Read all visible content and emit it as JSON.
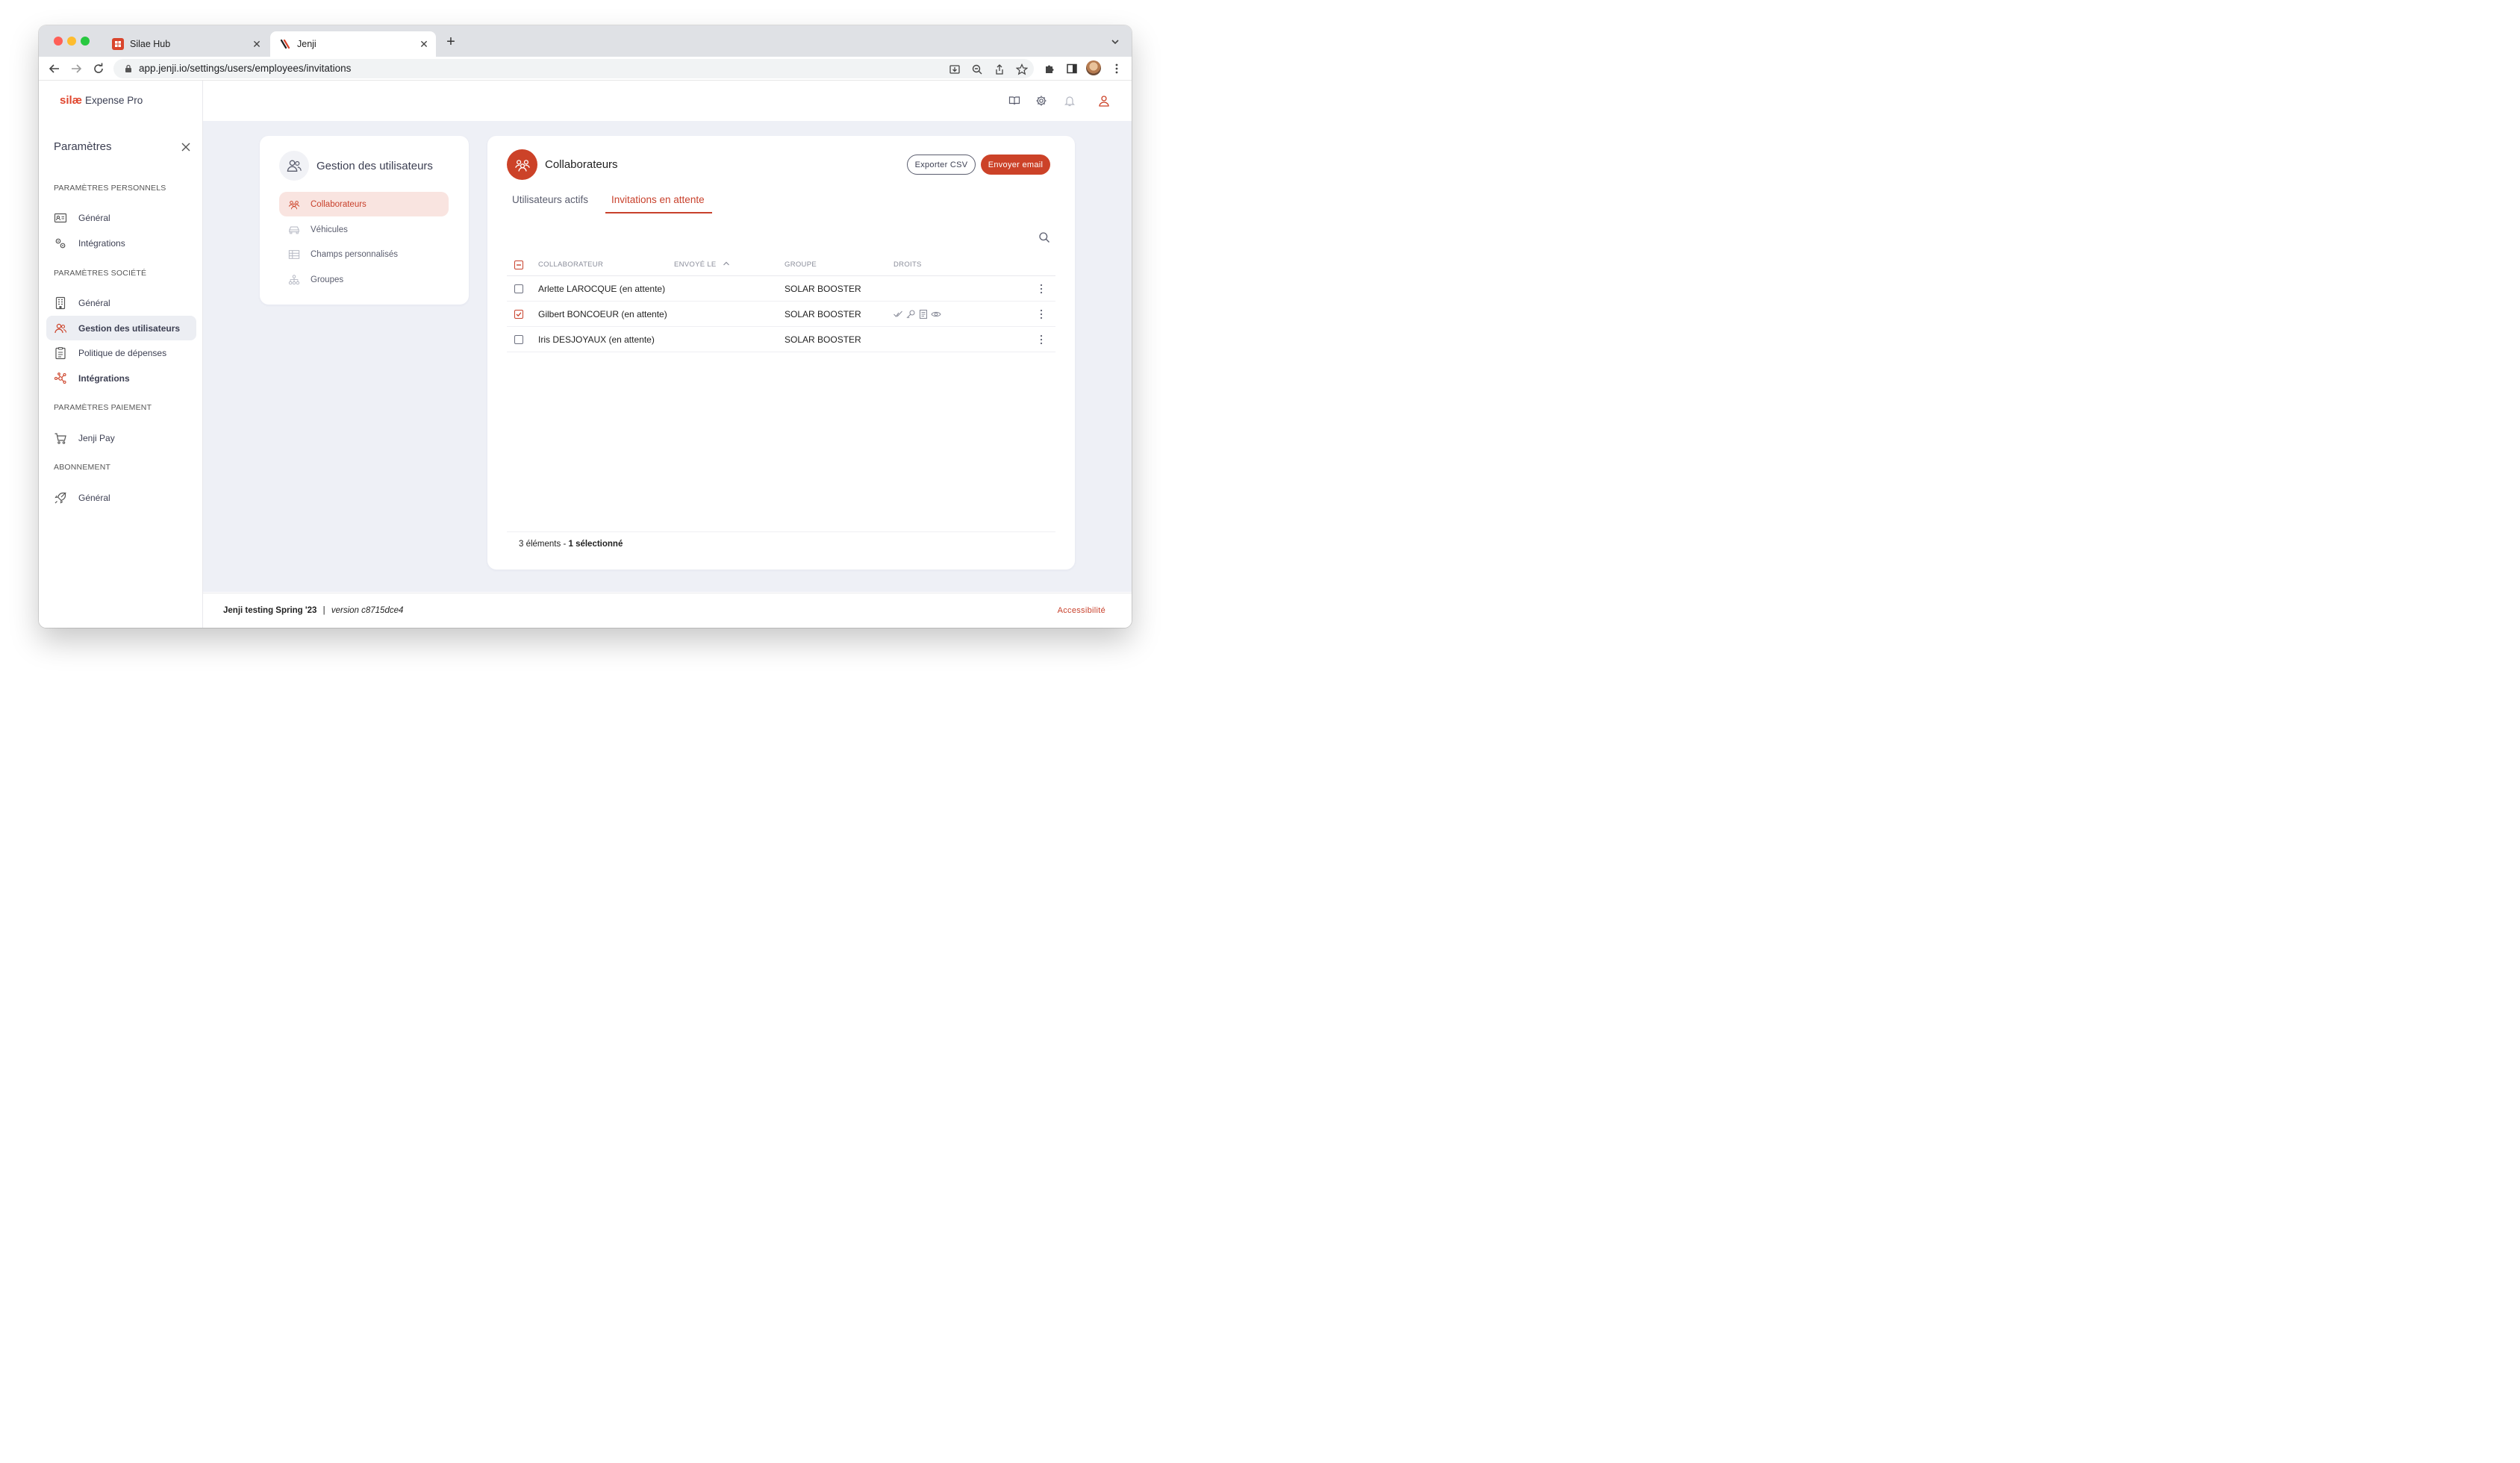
{
  "browser": {
    "tabs": [
      {
        "title": "Silae Hub",
        "active": false
      },
      {
        "title": "Jenji",
        "active": true
      }
    ],
    "url": "app.jenji.io/settings/users/employees/invitations",
    "new_tab_label": "+",
    "close_glyph": "✕"
  },
  "logo": {
    "mark": "silæ",
    "product": "Expense Pro"
  },
  "sidebar": {
    "title": "Paramètres",
    "sections": [
      {
        "label": "PARAMÈTRES PERSONNELS",
        "items": [
          {
            "label": "Général",
            "icon": "id-card-icon"
          },
          {
            "label": "Intégrations",
            "icon": "gears-icon"
          }
        ]
      },
      {
        "label": "PARAMÈTRES SOCIÉTÉ",
        "items": [
          {
            "label": "Général",
            "icon": "building-icon"
          },
          {
            "label": "Gestion des utilisateurs",
            "icon": "users-icon",
            "active": true
          },
          {
            "label": "Politique de dépenses",
            "icon": "clipboard-icon"
          },
          {
            "label": "Intégrations",
            "icon": "network-icon",
            "bold": true
          }
        ]
      },
      {
        "label": "PARAMÈTRES PAIEMENT",
        "items": [
          {
            "label": "Jenji Pay",
            "icon": "cart-icon"
          }
        ]
      },
      {
        "label": "ABONNEMENT",
        "items": [
          {
            "label": "Général",
            "icon": "rocket-icon"
          }
        ]
      }
    ]
  },
  "submenu": {
    "title": "Gestion des utilisateurs",
    "items": [
      {
        "label": "Collaborateurs",
        "icon": "users-icon",
        "active": true
      },
      {
        "label": "Véhicules",
        "icon": "car-icon"
      },
      {
        "label": "Champs personnalisés",
        "icon": "table-icon"
      },
      {
        "label": "Groupes",
        "icon": "hierarchy-icon"
      }
    ]
  },
  "main": {
    "title": "Collaborateurs",
    "export_label": "Exporter CSV",
    "send_label": "Envoyer email",
    "tabs": [
      {
        "label": "Utilisateurs actifs",
        "active": false
      },
      {
        "label": "Invitations en attente",
        "active": true
      }
    ],
    "columns": {
      "collaborator": "COLLABORATEUR",
      "sent": "ENVOYÉ LE",
      "group": "GROUPE",
      "rights": "DROITS"
    },
    "rows": [
      {
        "name": "Arlette LAROCQUE (en attente)",
        "group": "SOLAR BOOSTER",
        "checked": false,
        "rights": []
      },
      {
        "name": "Gilbert BONCOEUR (en attente)",
        "group": "SOLAR BOOSTER",
        "checked": true,
        "rights": [
          "check-icon",
          "key-icon",
          "document-icon",
          "eye-icon"
        ]
      },
      {
        "name": "Iris DESJOYAUX (en attente)",
        "group": "SOLAR BOOSTER",
        "checked": false,
        "rights": []
      }
    ],
    "count_text": "3 éléments - ",
    "selected_text": "1 sélectionné"
  },
  "footer": {
    "release": "Jenji testing Spring '23",
    "separator": "|",
    "version": "version c8715dce4",
    "accessibility": "Accessibilité"
  },
  "colors": {
    "accent": "#cc4228",
    "accent_light": "#f9e4e0",
    "background": "#eef0f6"
  }
}
